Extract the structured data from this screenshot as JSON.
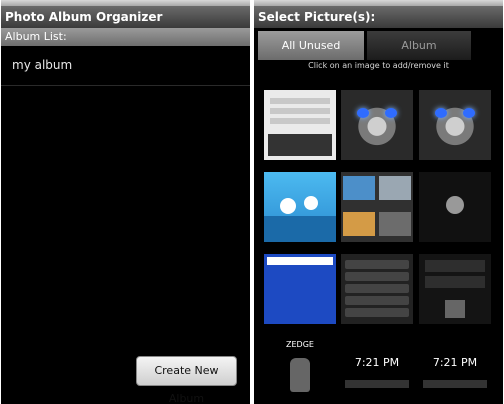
{
  "left_screen": {
    "title": "Photo Album Organizer",
    "section_header": "Album List:",
    "albums": [
      {
        "name": "my album"
      }
    ],
    "create_button_label": "Create New Album"
  },
  "right_screen": {
    "title": "Select Picture(s):",
    "tabs": [
      {
        "label": "All Unused",
        "selected": true
      },
      {
        "label": "Album",
        "selected": false
      }
    ],
    "hint": "Click on an image to add/remove it",
    "thumbnails": [
      {
        "name": "screenshot-form"
      },
      {
        "name": "cat-blue-eyes"
      },
      {
        "name": "cat-blue-eyes"
      },
      {
        "name": "cartoon-birds"
      },
      {
        "name": "photo-gallery"
      },
      {
        "name": "media-player"
      },
      {
        "name": "web-search"
      },
      {
        "name": "music-list"
      },
      {
        "name": "settings-wallpaper"
      },
      {
        "name": "zedge-droid"
      },
      {
        "name": "alarm-clock-721"
      },
      {
        "name": "alarm-clock-721"
      }
    ],
    "clock_text": "7:21 PM",
    "zedge_text": "ZEDGE"
  },
  "colors": {
    "background": "#000000",
    "title_bar": "#4a4a4a",
    "section_header": "#808080",
    "accent_blue": "#2f6cff"
  }
}
